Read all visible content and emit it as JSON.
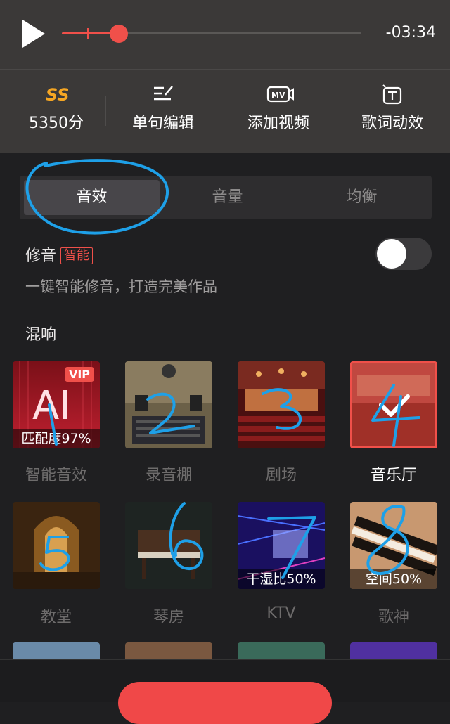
{
  "player": {
    "time": "-03:34",
    "progress": 0.19
  },
  "toolbar": [
    {
      "icon": "score-icon",
      "label": "5350分"
    },
    {
      "icon": "edit-line-icon",
      "label": "单句编辑"
    },
    {
      "icon": "mv-icon",
      "label": "添加视频"
    },
    {
      "icon": "lyric-effect-icon",
      "label": "歌词动效"
    }
  ],
  "tabs": [
    {
      "label": "音效",
      "active": true
    },
    {
      "label": "音量",
      "active": false
    },
    {
      "label": "均衡",
      "active": false
    }
  ],
  "repair": {
    "title": "修音",
    "badge": "智能",
    "desc": "一键智能修音，打造完美作品",
    "enabled": false
  },
  "reverb": {
    "title": "混响",
    "items": [
      {
        "name": "智能音效",
        "caption": "匹配度97%",
        "vip": "VIP",
        "selected": false
      },
      {
        "name": "录音棚",
        "caption": "",
        "selected": false
      },
      {
        "name": "剧场",
        "caption": "",
        "selected": false
      },
      {
        "name": "音乐厅",
        "caption": "",
        "selected": true
      },
      {
        "name": "教堂",
        "caption": "",
        "selected": false
      },
      {
        "name": "琴房",
        "caption": "",
        "selected": false
      },
      {
        "name": "KTV",
        "caption": "干湿比50%",
        "selected": false
      },
      {
        "name": "歌神",
        "caption": "空间50%",
        "selected": false
      }
    ]
  },
  "colors": {
    "accent": "#f0504a",
    "annotation": "#1ea0e8",
    "toolbar_bg": "#3b3938",
    "page_bg": "#1f1f21"
  }
}
